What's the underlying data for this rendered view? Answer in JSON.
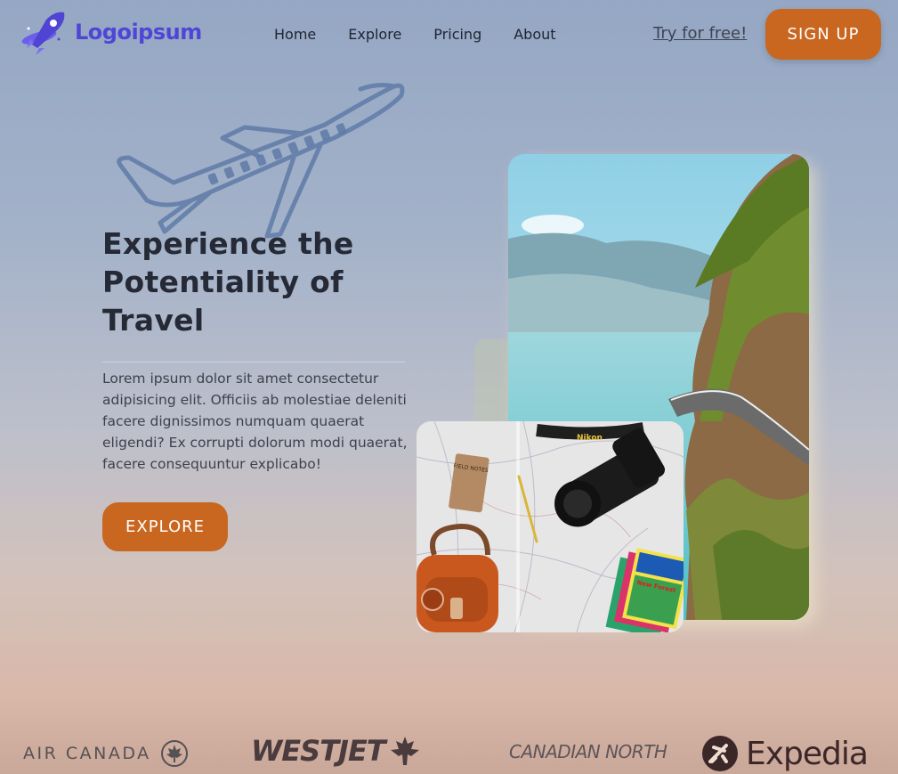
{
  "brand": {
    "name": "Logoipsum",
    "icon": "rocket-logo-icon",
    "color": "#5046d6"
  },
  "nav": {
    "items": [
      {
        "label": "Home"
      },
      {
        "label": "Explore"
      },
      {
        "label": "Pricing"
      },
      {
        "label": "About"
      }
    ]
  },
  "header": {
    "try_label": "Try for free!",
    "signup_label": "SIGN UP"
  },
  "hero": {
    "title": "Experience the Potentiality of Travel",
    "description": "Lorem ipsum dolor sit amet consectetur adipisicing elit. Officiis ab molestiae deleniti facere dignissimos numquam quaerat eligendi? Ex corrupti dolorum modi quaerat, facere consequuntur explicabo!",
    "cta_label": "EXPLORE",
    "illustration": "airplane-outline-icon"
  },
  "images": {
    "cliff": "coastal-cliff-road-photo",
    "map": "travel-map-camera-photo",
    "map_items": {
      "notebook": "FIELD NOTES",
      "strap": "Nikon",
      "guide": "New Forest"
    }
  },
  "partners": [
    {
      "name": "AIR CANADA"
    },
    {
      "name": "WESTJET"
    },
    {
      "name": "CANADIAN NORTH"
    },
    {
      "name": "Expedia"
    }
  ],
  "colors": {
    "accent": "#c9661f",
    "text_dark": "#262a36"
  }
}
